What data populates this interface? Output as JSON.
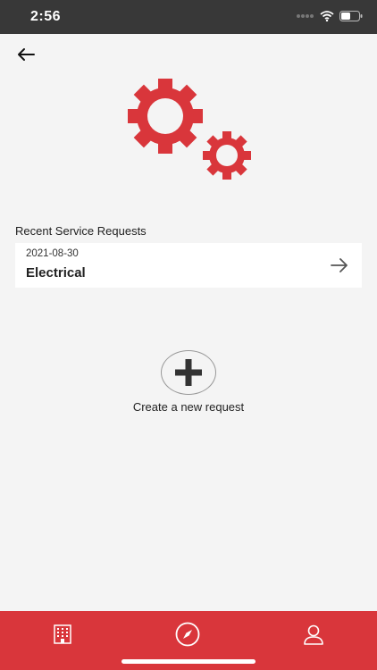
{
  "status_bar": {
    "time": "2:56"
  },
  "header": {
    "back_icon": "arrow-left-icon"
  },
  "hero": {
    "icon": "gears-icon",
    "color": "#d9363b"
  },
  "recent_requests": {
    "title": "Recent Service Requests",
    "items": [
      {
        "date": "2021-08-30",
        "type": "Electrical",
        "icon": "arrow-right-icon"
      }
    ]
  },
  "create": {
    "icon": "plus-icon",
    "label": "Create a new request"
  },
  "tab_bar": {
    "color": "#d9363b",
    "tabs": [
      {
        "icon": "building-icon"
      },
      {
        "icon": "compass-icon"
      },
      {
        "icon": "user-icon"
      }
    ]
  }
}
